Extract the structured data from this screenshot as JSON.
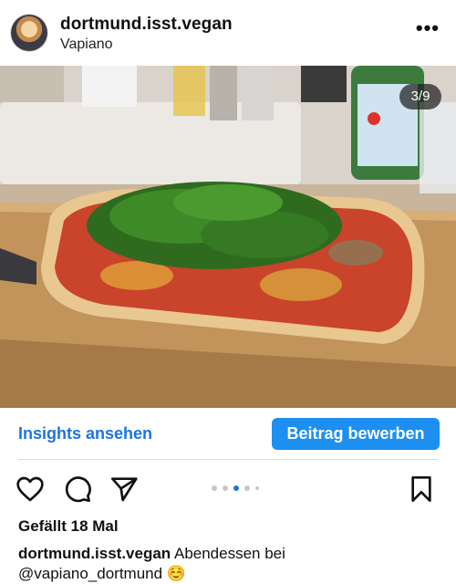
{
  "post": {
    "username": "dortmund.isst.vegan",
    "location": "Vapiano",
    "more_icon": "more-horizontal-icon",
    "image_counter": "3/9",
    "image_alt": "Vegan flatbread pizza with arugula on a wooden board",
    "carousel": {
      "total_dots": 5,
      "active_index": 2
    },
    "likes": "Gefällt 18 Mal",
    "caption_user": "dortmund.isst.vegan",
    "caption_text_1": "Abendessen bei",
    "caption_mention": "@vapiano_dortmund",
    "caption_emoji": "☺️"
  },
  "actions": {
    "insights_label": "Insights ansehen",
    "promote_label": "Beitrag bewerben",
    "like_icon": "heart-icon",
    "comment_icon": "comment-icon",
    "share_icon": "send-icon",
    "save_icon": "bookmark-icon"
  },
  "colors": {
    "accent": "#1b74e4",
    "button": "#1d8ff0",
    "divider": "#dbdbdb"
  }
}
